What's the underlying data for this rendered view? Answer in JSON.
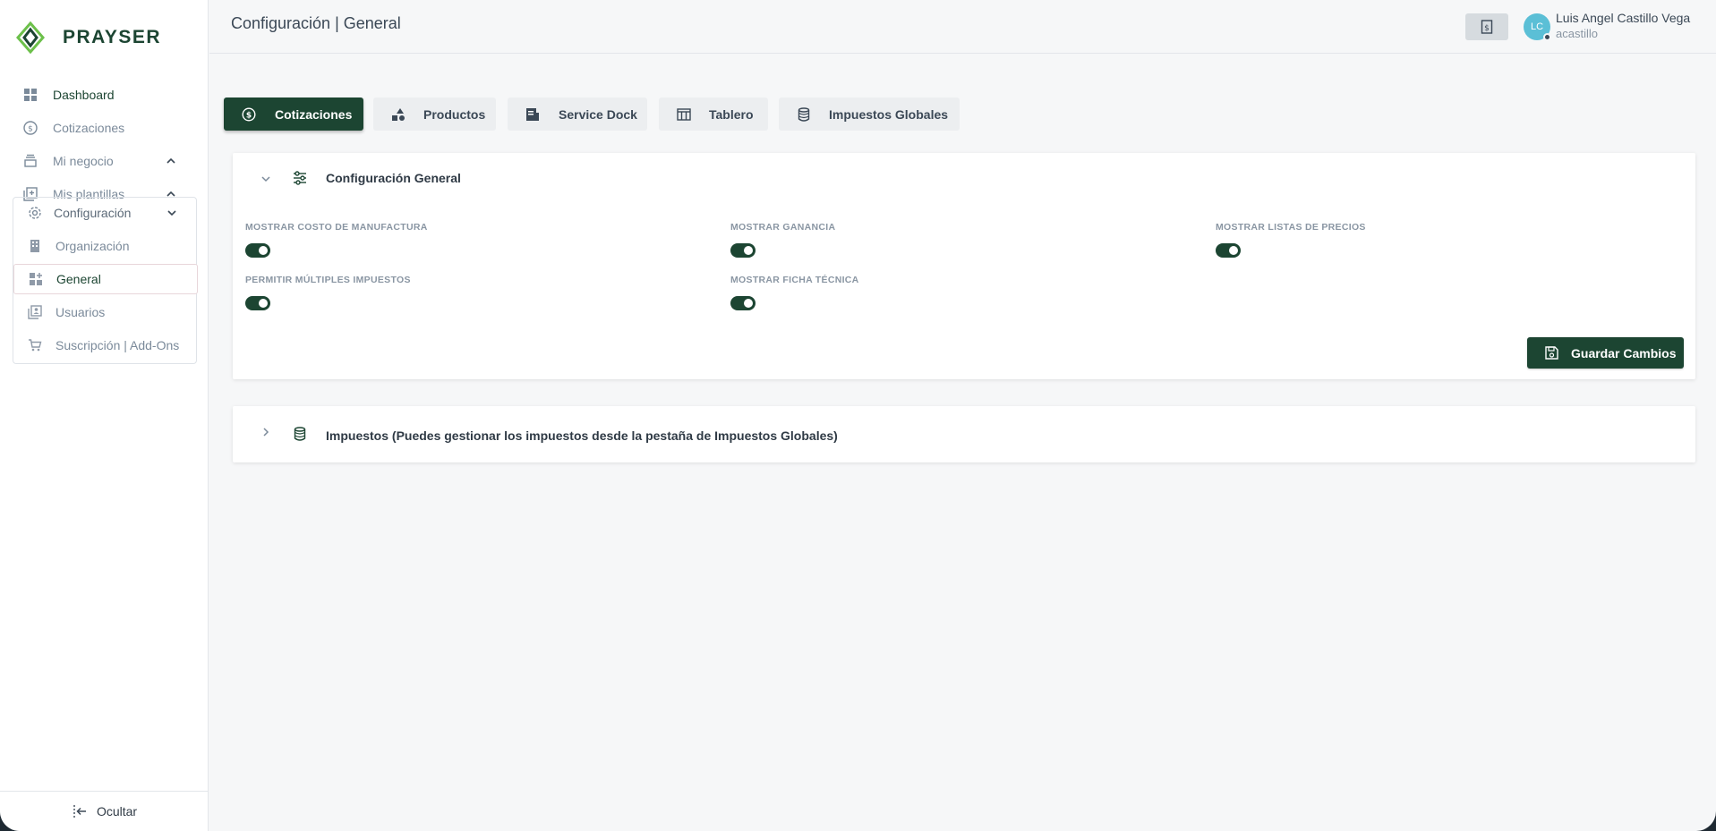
{
  "brand": {
    "name": "PRAYSER",
    "accent": "#1c4532",
    "logo_green": "#6cc04a"
  },
  "sidebar": {
    "items": [
      {
        "label": "Dashboard",
        "icon": "dashboard-icon"
      },
      {
        "label": "Cotizaciones",
        "icon": "dollar-circle-icon"
      },
      {
        "label": "Mi negocio",
        "icon": "box-stack-icon"
      },
      {
        "label": "Mis plantillas",
        "icon": "template-plus-icon"
      }
    ],
    "config": {
      "label": "Configuración",
      "items": [
        {
          "label": "Organización",
          "icon": "building-icon"
        },
        {
          "label": "General",
          "icon": "grid-plus-icon"
        },
        {
          "label": "Usuarios",
          "icon": "users-icon"
        },
        {
          "label": "Suscripción | Add-Ons",
          "icon": "cart-icon"
        }
      ]
    },
    "hide_label": "Ocultar"
  },
  "header": {
    "title": "Configuración | General",
    "user": {
      "initials": "LC",
      "name": "Luis Angel Castillo Vega",
      "handle": "acastillo"
    }
  },
  "tabs": [
    {
      "label": "Cotizaciones",
      "icon": "dollar-circle-icon",
      "active": true
    },
    {
      "label": "Productos",
      "icon": "shapes-icon"
    },
    {
      "label": "Service Dock",
      "icon": "document-icon"
    },
    {
      "label": "Tablero",
      "icon": "columns-icon"
    },
    {
      "label": "Impuestos Globales",
      "icon": "database-icon"
    }
  ],
  "general_card": {
    "title": "Configuración General",
    "settings": [
      {
        "label": "Mostrar costo de manufactura",
        "enabled": true
      },
      {
        "label": "Mostrar ganancia",
        "enabled": true
      },
      {
        "label": "Mostrar listas de precios",
        "enabled": true
      },
      {
        "label": "Permitir múltiples impuestos",
        "enabled": true
      },
      {
        "label": "Mostrar ficha técnica",
        "enabled": true
      }
    ],
    "save_label": "Guardar Cambios"
  },
  "taxes_card": {
    "title": "Impuestos (Puedes gestionar los impuestos desde la pestaña de Impuestos Globales)"
  }
}
